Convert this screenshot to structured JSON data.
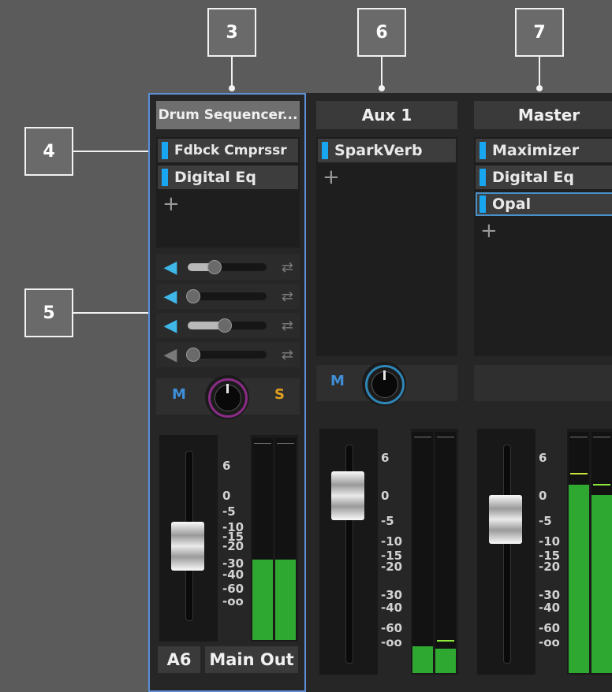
{
  "callouts": [
    "3",
    "6",
    "7",
    "4",
    "5"
  ],
  "strips": {
    "drum": {
      "name": "Drum Sequencer...",
      "effects": [
        "Fdbck Cmprssr",
        "Digital Eq"
      ],
      "add_label": "+",
      "sends": [
        {
          "level": 0.33,
          "active": true
        },
        {
          "level": 0.0,
          "active": true
        },
        {
          "level": 0.46,
          "active": true
        },
        {
          "level": 0.0,
          "active": false
        }
      ],
      "mute_label": "M",
      "solo_label": "S",
      "fader_scale": [
        "6",
        "0",
        "-5",
        "-10",
        "-15",
        "-20",
        "-30",
        "-40",
        "-60",
        "-oo"
      ],
      "input_label": "A6",
      "output_label": "Main Out",
      "meter_levels": [
        0.4,
        0.4
      ]
    },
    "aux": {
      "name": "Aux 1",
      "effects": [
        "SparkVerb"
      ],
      "add_label": "+",
      "mute_label": "M",
      "fader_scale": [
        "6",
        "0",
        "-5",
        "-10",
        "-15",
        "-20",
        "-30",
        "-40",
        "-60",
        "-oo"
      ],
      "meter_levels": [
        0.11,
        0.1
      ]
    },
    "master": {
      "name": "Master",
      "effects": [
        "Maximizer",
        "Digital Eq",
        "Opal"
      ],
      "add_label": "+",
      "fader_scale": [
        "6",
        "0",
        "-5",
        "-10",
        "-15",
        "-20",
        "-30",
        "-40",
        "-60",
        "-oo"
      ],
      "meter_levels": [
        0.78,
        0.74
      ]
    }
  },
  "colors": {
    "selection_outline": "#5f8fd6",
    "plugin_indicator": "#19a6f0",
    "send_icon": "#3fb8e8",
    "mute": "#3f8fd8",
    "solo": "#e0a020",
    "meter_green": "#2ea830"
  },
  "icons": {
    "send": "share-icon",
    "route": "route-icon",
    "add": "plus-icon"
  }
}
